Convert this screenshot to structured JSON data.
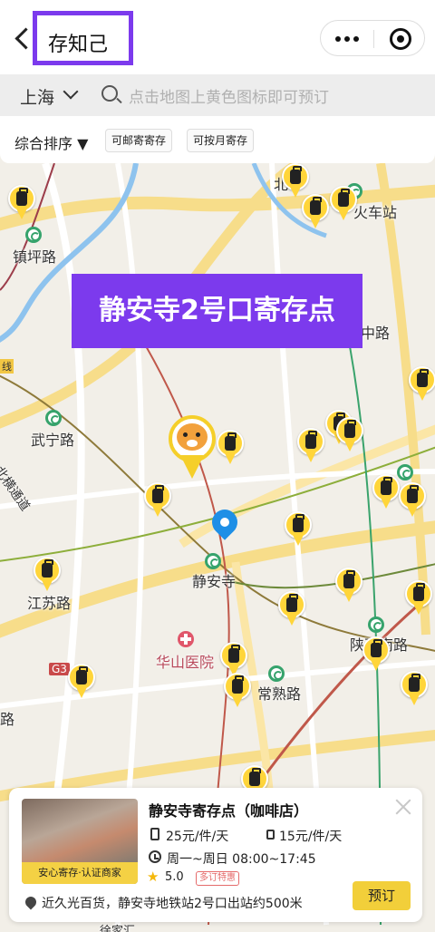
{
  "header": {
    "title": "存知己"
  },
  "search": {
    "city": "上海",
    "placeholder": "点击地图上黄色图标即可预订"
  },
  "filters": {
    "sort_label": "综合排序 ▼",
    "chips": [
      "可邮寄寄存",
      "可按月寄存"
    ]
  },
  "highlight_label": "静安寺2号口寄存点",
  "map": {
    "labels": [
      "镇坪路",
      "武宁路",
      "北横通道",
      "静安寺",
      "华山医院",
      "常熟路",
      "陕西南路",
      "江苏路",
      "中路",
      "火车站",
      "G3",
      "路",
      "线",
      "北",
      "徐家汇"
    ],
    "colors": {
      "pin_yellow": "#ffd53a",
      "metro_green": "#36a36c",
      "location_blue": "#1e8fe6",
      "highlight_purple": "#7c3aed"
    }
  },
  "card": {
    "title": "静安寺寄存点（咖啡店）",
    "badge": "安心寄存·认证商家",
    "price_large": "25元/件/天",
    "price_small": "15元/件/天",
    "hours": "周一~周日 08:00~17:45",
    "rating": "5.0",
    "promo": "多订特惠",
    "address": "近久光百货，静安寺地铁站2号口出站约500米",
    "book_label": "预订"
  }
}
